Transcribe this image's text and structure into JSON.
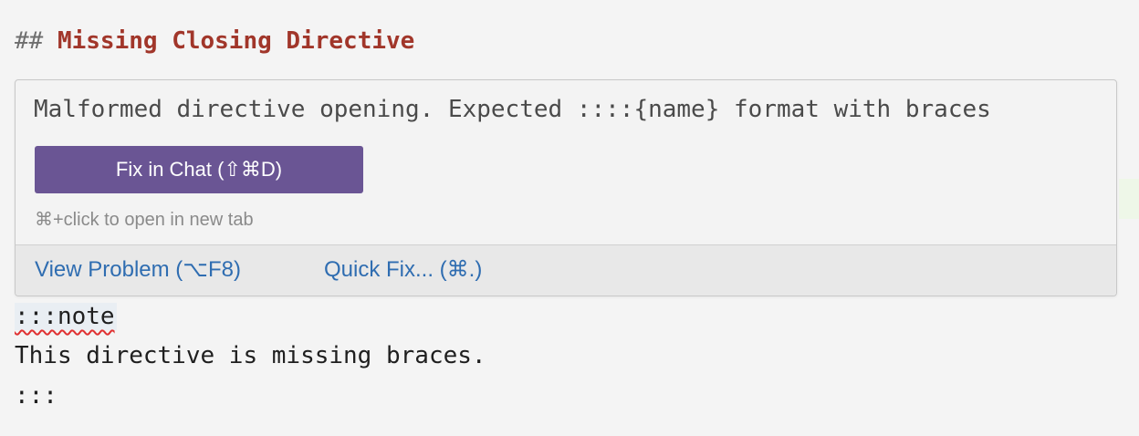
{
  "editor": {
    "heading_marker": "## ",
    "heading_text": "Missing Closing Directive",
    "code_lines": [
      ":::note",
      "This directive is missing braces.",
      ":::"
    ]
  },
  "hover": {
    "message": "Malformed directive opening. Expected ::::{name} format with braces",
    "fix_button_label": "Fix in Chat (⇧⌘D)",
    "hint": "⌘+click to open in new tab",
    "actions": {
      "view_problem": "View Problem (⌥F8)",
      "quick_fix": "Quick Fix... (⌘.)"
    }
  },
  "colors": {
    "heading": "#a1362a",
    "button": "#6a5594",
    "link": "#2f6db1",
    "error_squiggle": "#e03131"
  }
}
